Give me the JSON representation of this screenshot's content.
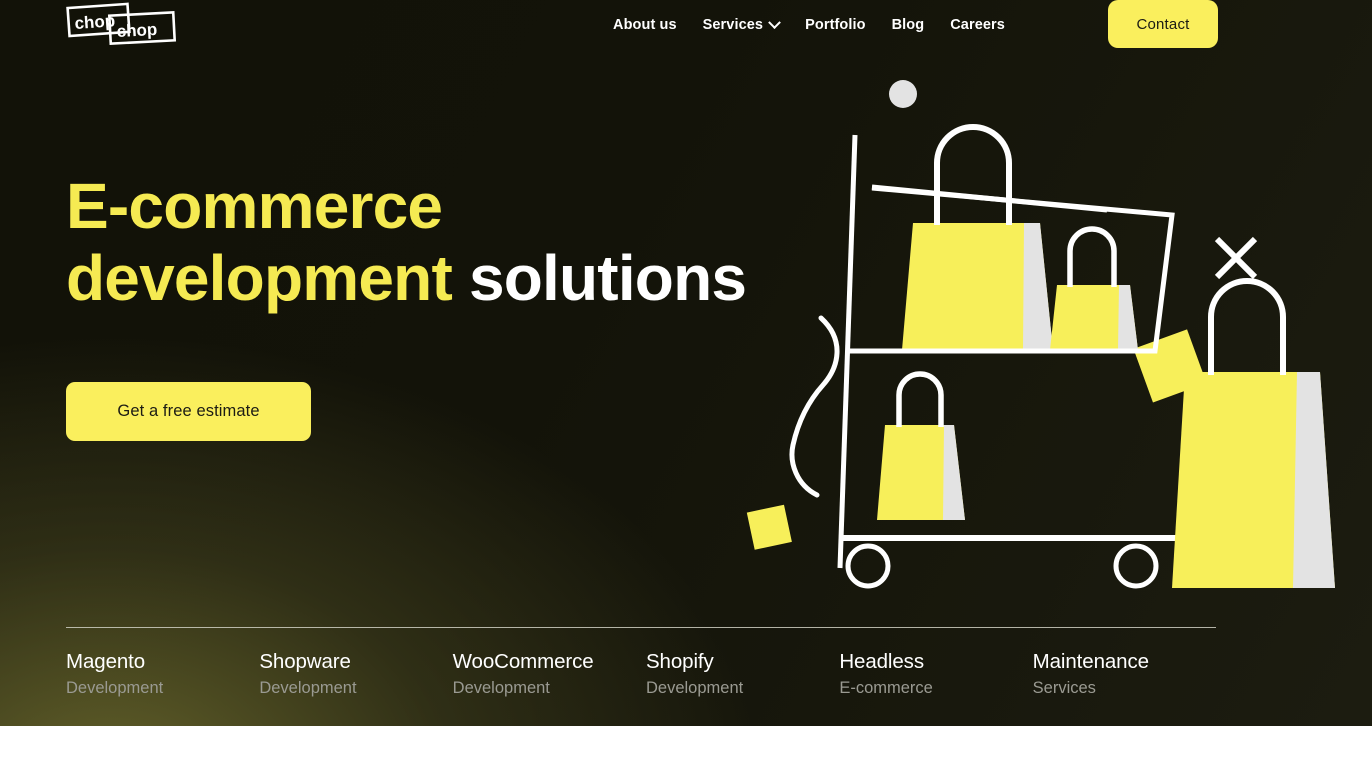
{
  "brand": {
    "logo_text_1": "chop",
    "logo_text_2": "chop",
    "accent_color": "#faef5d",
    "background_dark": "#121208"
  },
  "header": {
    "nav": [
      {
        "label": "About us",
        "has_dropdown": false
      },
      {
        "label": "Services",
        "has_dropdown": true
      },
      {
        "label": "Portfolio",
        "has_dropdown": false
      },
      {
        "label": "Blog",
        "has_dropdown": false
      },
      {
        "label": "Careers",
        "has_dropdown": false
      }
    ],
    "contact_label": "Contact"
  },
  "hero": {
    "headline_accent": "E-commerce development",
    "headline_rest": "solutions",
    "cta_label": "Get a free estimate"
  },
  "services": [
    {
      "title": "Magento",
      "subtitle": "Development"
    },
    {
      "title": "Shopware",
      "subtitle": "Development"
    },
    {
      "title": "WooCommerce",
      "subtitle": "Development"
    },
    {
      "title": "Shopify",
      "subtitle": "Development"
    },
    {
      "title": "Headless",
      "subtitle": "E-commerce"
    },
    {
      "title": "Maintenance",
      "subtitle": "Services"
    }
  ],
  "illustration": {
    "name": "shopping-cart-with-bags",
    "bag_color": "#f7ef5a",
    "bag_side_color": "#e3e3e3",
    "outline_color": "#ffffff",
    "elements": [
      "shopping-cart",
      "shopping-bag-large",
      "shopping-bag-medium",
      "shopping-bag-small",
      "shopping-bag-right",
      "circle-dot",
      "square-top",
      "square-bottom",
      "x-mark",
      "squiggle"
    ]
  }
}
